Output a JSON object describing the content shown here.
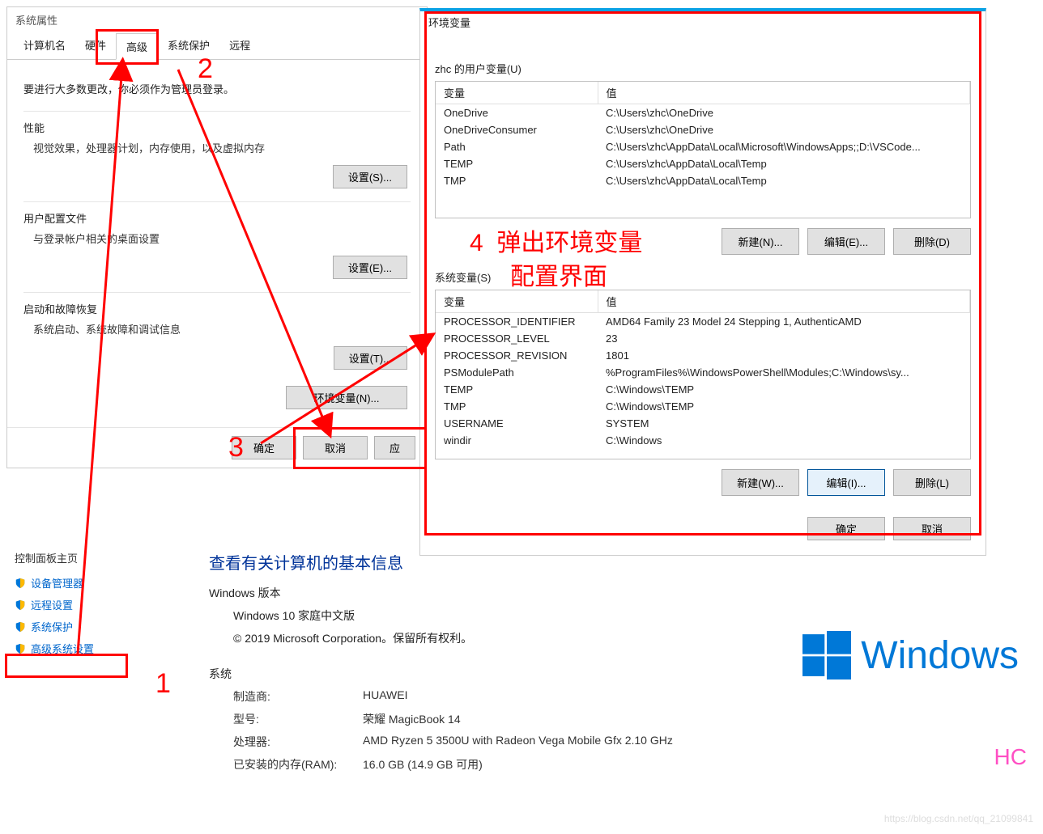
{
  "sysprops": {
    "title": "系统属性",
    "tabs": [
      "计算机名",
      "硬件",
      "高级",
      "系统保护",
      "远程"
    ],
    "active_tab": "高级",
    "note": "要进行大多数更改，你必须作为管理员登录。",
    "groups": [
      {
        "title": "性能",
        "desc": "视觉效果，处理器计划，内存使用，以及虚拟内存",
        "btn": "设置(S)..."
      },
      {
        "title": "用户配置文件",
        "desc": "与登录帐户相关的桌面设置",
        "btn": "设置(E)..."
      },
      {
        "title": "启动和故障恢复",
        "desc": "系统启动、系统故障和调试信息",
        "btn": "设置(T)..."
      }
    ],
    "env_btn": "环境变量(N)...",
    "footer": {
      "ok": "确定",
      "cancel": "取消",
      "apply": "应"
    }
  },
  "envdlg": {
    "title": "环境变量",
    "user_section": "zhc 的用户变量(U)",
    "sys_section": "系统变量(S)",
    "col_var": "变量",
    "col_val": "值",
    "user_vars": [
      {
        "k": "OneDrive",
        "v": "C:\\Users\\zhc\\OneDrive"
      },
      {
        "k": "OneDriveConsumer",
        "v": "C:\\Users\\zhc\\OneDrive"
      },
      {
        "k": "Path",
        "v": "C:\\Users\\zhc\\AppData\\Local\\Microsoft\\WindowsApps;;D:\\VSCode..."
      },
      {
        "k": "TEMP",
        "v": "C:\\Users\\zhc\\AppData\\Local\\Temp"
      },
      {
        "k": "TMP",
        "v": "C:\\Users\\zhc\\AppData\\Local\\Temp"
      }
    ],
    "sys_vars": [
      {
        "k": "PROCESSOR_IDENTIFIER",
        "v": "AMD64 Family 23 Model 24 Stepping 1, AuthenticAMD"
      },
      {
        "k": "PROCESSOR_LEVEL",
        "v": "23"
      },
      {
        "k": "PROCESSOR_REVISION",
        "v": "1801"
      },
      {
        "k": "PSModulePath",
        "v": "%ProgramFiles%\\WindowsPowerShell\\Modules;C:\\Windows\\sy..."
      },
      {
        "k": "TEMP",
        "v": "C:\\Windows\\TEMP"
      },
      {
        "k": "TMP",
        "v": "C:\\Windows\\TEMP"
      },
      {
        "k": "USERNAME",
        "v": "SYSTEM"
      },
      {
        "k": "windir",
        "v": "C:\\Windows"
      }
    ],
    "user_btns": {
      "new": "新建(N)...",
      "edit": "编辑(E)...",
      "del": "删除(D)"
    },
    "sys_btns": {
      "new": "新建(W)...",
      "edit": "编辑(I)...",
      "del": "删除(L)"
    },
    "footer": {
      "ok": "确定",
      "cancel": "取消"
    }
  },
  "cpanel": {
    "side_title": "控制面板主页",
    "links": [
      "设备管理器",
      "远程设置",
      "系统保护",
      "高级系统设置"
    ],
    "heading": "查看有关计算机的基本信息",
    "edition_title": "Windows 版本",
    "edition": "Windows 10 家庭中文版",
    "copyright": "© 2019 Microsoft Corporation。保留所有权利。",
    "system_title": "系统",
    "rows": [
      {
        "k": "制造商:",
        "v": "HUAWEI"
      },
      {
        "k": "型号:",
        "v": "荣耀 MagicBook 14"
      },
      {
        "k": "处理器:",
        "v": "AMD Ryzen 5 3500U with Radeon Vega Mobile Gfx    2.10 GHz"
      },
      {
        "k": "已安装的内存(RAM):",
        "v": "16.0 GB (14.9 GB 可用)"
      }
    ],
    "winword": "Windows",
    "hc": "HC"
  },
  "anno": {
    "n1": "1",
    "n2": "2",
    "n3": "3",
    "popup": "4  弹出环境变量\n      配置界面"
  },
  "watermark": "https://blog.csdn.net/qq_21099841"
}
